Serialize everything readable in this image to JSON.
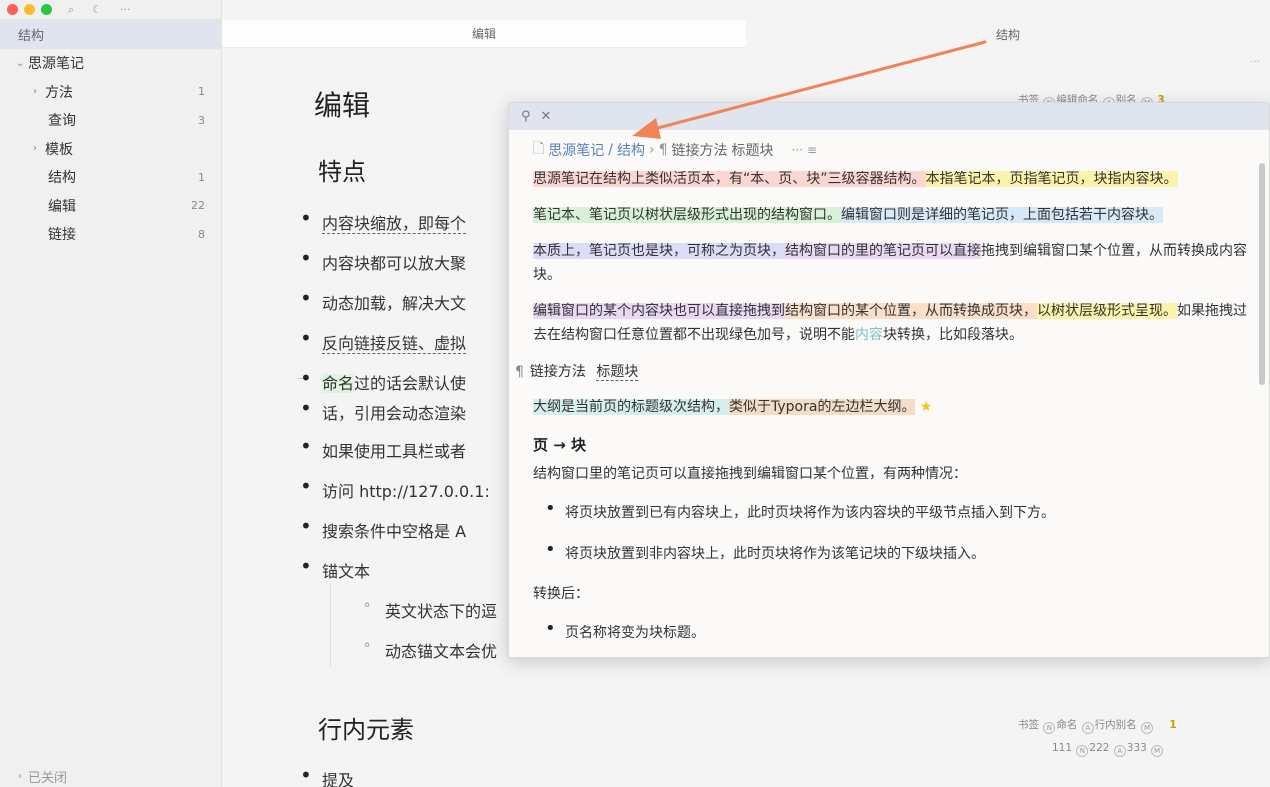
{
  "sidebar": {
    "header": "结构",
    "notebook": "思源笔记",
    "items": [
      {
        "label": "方法",
        "count": "1",
        "arrow": true
      },
      {
        "label": "查询",
        "count": "3",
        "arrow": false
      },
      {
        "label": "模板",
        "count": "",
        "arrow": true
      },
      {
        "label": "结构",
        "count": "1",
        "arrow": false
      },
      {
        "label": "编辑",
        "count": "22",
        "arrow": false
      },
      {
        "label": "链接",
        "count": "8",
        "arrow": false
      }
    ],
    "closed": "已关闭"
  },
  "tabs": {
    "edit": "编辑",
    "structure": "结构"
  },
  "editor": {
    "title": "编辑",
    "heading_features": "特点",
    "list": [
      "内容块缩放，即每个",
      "内容块都可以放大聚",
      "动态加载，解决大文",
      "反向链接反链、虚拟",
      "过的话会默认使",
      "话，引用会动态渲染",
      "如果使用工具栏或者",
      "访问  http://127.0.0.1:",
      "搜索条件中空格是 A",
      "锚文本"
    ],
    "named_word": "命名",
    "sub_list": [
      "英文状态下的逗",
      "动态锚文本会优"
    ],
    "heading_inline": "行内元素",
    "mention": "提及",
    "meta_top": {
      "bookmark": "书签",
      "name": "编辑命名",
      "alias": "别名",
      "count": "3"
    },
    "meta_bottom1": {
      "bookmark": "书签",
      "name": "命名",
      "alias": "行内别名",
      "count": "1"
    },
    "meta_bottom2": {
      "a": "111",
      "b": "222",
      "c": "333"
    }
  },
  "popup": {
    "breadcrumb": {
      "notebook": "思源笔记",
      "doc": "结构",
      "heading": "链接方法",
      "type": "标题块"
    },
    "p1": {
      "a": "思源笔记在结构上类似活页本，有“本、页、块”三级容器结构。",
      "b": "本指笔记本，页指笔记页，块指内容块。"
    },
    "p2": {
      "a": "笔记本、笔记页以树状层级形式出现的结构窗口。",
      "b": "编辑窗口则是详细的笔记页，上面包括若干内容块。"
    },
    "p3": {
      "a": "本质上，笔记页也是块，可称之为页块，",
      "b": "结构窗口的里的笔记页可以直接",
      "c": "拖拽到编辑窗口某个位置，从而转换成内容块。"
    },
    "p4": {
      "a": "编辑窗口的某个内容块也可以直接拖拽到",
      "b": "结构窗口的某个位置，从而转换成页块，",
      "c": "以树状层级形式呈现。",
      "d": "如果拖拽过去在结构窗口任意位置都不出现绿色加号，说明不能",
      "e": "内容",
      "f": "块转换，比如段落块。"
    },
    "heading_row": {
      "a": "链接方法",
      "b": "标题块"
    },
    "p5": {
      "a": "大纲是当前页的标题级次结构，",
      "b": "类似于Typora的左边栏大纲。"
    },
    "h3": "页 → 块",
    "p6": "结构窗口里的笔记页可以直接拖拽到编辑窗口某个位置，有两种情况：",
    "li1": "将页块放置到已有内容块上，此时页块将作为该内容块的平级节点插入到下方。",
    "li2": "将页块放置到非内容块上，此时页块将作为该笔记块的下级块插入。",
    "p7": "转换后：",
    "li3": "页名称将变为块标题。"
  },
  "colors": {
    "arrow": "#f08457",
    "header_bg": "#dfe4ef",
    "link": "#5b82b8"
  }
}
